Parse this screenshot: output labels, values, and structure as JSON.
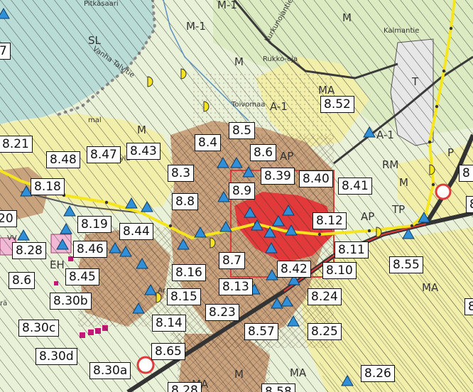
{
  "map": {
    "colors": {
      "background": "#e9f2d8",
      "agricultural": "#dcebc2",
      "water": "#b9dcd6",
      "yellow_zone": "#f2efaa",
      "housing": "#c9a27e",
      "centre_red": "#e23a3a",
      "industry": "#e7e7e7",
      "service_pink": "#f2b9d6",
      "route_yellow": "#f5e51e",
      "marker_blue": "#2f8fd8"
    },
    "zone_labels": [
      {
        "id": "sl",
        "text": "SL"
      },
      {
        "id": "m1-top",
        "text": "M-1"
      },
      {
        "id": "m1-mid",
        "text": "M-1"
      },
      {
        "id": "m-ne",
        "text": "M"
      },
      {
        "id": "m-n",
        "text": "M"
      },
      {
        "id": "m-w",
        "text": "M"
      },
      {
        "id": "ma-n",
        "text": "MA"
      },
      {
        "id": "a1-n",
        "text": "A-1"
      },
      {
        "id": "a1-e",
        "text": "A-1"
      },
      {
        "id": "t-e",
        "text": "T"
      },
      {
        "id": "p-e",
        "text": "P"
      },
      {
        "id": "ap-c",
        "text": "AP"
      },
      {
        "id": "ap-e",
        "text": "AP"
      },
      {
        "id": "rm-e",
        "text": "RM"
      },
      {
        "id": "m-e",
        "text": "M"
      },
      {
        "id": "tp-e",
        "text": "TP"
      },
      {
        "id": "ma-e",
        "text": "MA"
      },
      {
        "id": "eh-w",
        "text": "EH"
      },
      {
        "id": "ma-s",
        "text": "MA"
      },
      {
        "id": "m-s",
        "text": "M"
      },
      {
        "id": "ma-s2",
        "text": "MA"
      },
      {
        "id": "mal",
        "text": "mal"
      },
      {
        "id": "ar",
        "text": "Ar"
      },
      {
        "id": "ra",
        "text": "rä"
      },
      {
        "id": "vv",
        "text": "VV"
      }
    ],
    "place_names": [
      {
        "id": "kurkunojantie",
        "text": "Kurkunojantie"
      },
      {
        "id": "rukko-oja",
        "text": "Rukko-oja"
      },
      {
        "id": "kalmantie",
        "text": "Kalmantie"
      },
      {
        "id": "vanha-talvitie",
        "text": "Vanha Talvitie"
      },
      {
        "id": "rantakyla",
        "text": "Rantakylä"
      },
      {
        "id": "pitkasaari",
        "text": "Pitkäsaari"
      },
      {
        "id": "toivomaa",
        "text": "Toivomaa"
      }
    ],
    "callouts": [
      {
        "id": "7",
        "text": "7"
      },
      {
        "id": "8.52",
        "text": "8.52"
      },
      {
        "id": "8.5",
        "text": "8.5"
      },
      {
        "id": "8.21",
        "text": "8.21"
      },
      {
        "id": "8.48",
        "text": "8.48"
      },
      {
        "id": "8.47",
        "text": "8.47"
      },
      {
        "id": "8.43",
        "text": "8.43"
      },
      {
        "id": "8.4",
        "text": "8.4"
      },
      {
        "id": "8.6",
        "text": "8.6"
      },
      {
        "id": "8.39",
        "text": "8.39"
      },
      {
        "id": "8.40",
        "text": "8.40"
      },
      {
        "id": "8.41",
        "text": "8.41"
      },
      {
        "id": "8.3",
        "text": "8.3"
      },
      {
        "id": "8.9",
        "text": "8.9"
      },
      {
        "id": "8.18",
        "text": "8.18"
      },
      {
        "id": "8.8",
        "text": "8.8"
      },
      {
        "id": "20",
        "text": "20"
      },
      {
        "id": "8.19",
        "text": "8.19"
      },
      {
        "id": "8.44",
        "text": "8.44"
      },
      {
        "id": "8.12",
        "text": "8.12"
      },
      {
        "id": "8.28",
        "text": "8.28"
      },
      {
        "id": "8.46",
        "text": "8.46"
      },
      {
        "id": "8.11",
        "text": "8.11"
      },
      {
        "id": "8.7",
        "text": "8.7"
      },
      {
        "id": "8.55",
        "text": "8.55"
      },
      {
        "id": "8.6b",
        "text": "8.6"
      },
      {
        "id": "8.45",
        "text": "8.45"
      },
      {
        "id": "8.16",
        "text": "8.16"
      },
      {
        "id": "8.42",
        "text": "8.42"
      },
      {
        "id": "8.10",
        "text": "8.10"
      },
      {
        "id": "8.30b",
        "text": "8.30b"
      },
      {
        "id": "8.15",
        "text": "8.15"
      },
      {
        "id": "8.13",
        "text": "8.13"
      },
      {
        "id": "8.24",
        "text": "8.24"
      },
      {
        "id": "8.23",
        "text": "8.23"
      },
      {
        "id": "8.30c",
        "text": "8.30c"
      },
      {
        "id": "8.14",
        "text": "8.14"
      },
      {
        "id": "8.57",
        "text": "8.57"
      },
      {
        "id": "8.25",
        "text": "8.25"
      },
      {
        "id": "8.30d",
        "text": "8.30d"
      },
      {
        "id": "8.65",
        "text": "8.65"
      },
      {
        "id": "8.30a",
        "text": "8.30a"
      },
      {
        "id": "8.26",
        "text": "8.26"
      },
      {
        "id": "8.28b",
        "text": "8.28"
      },
      {
        "id": "8.58",
        "text": "8.58"
      },
      {
        "id": "8-edge-r1",
        "text": "8"
      },
      {
        "id": "8-edge-r2",
        "text": "8"
      },
      {
        "id": "8-edge-r3",
        "text": "8"
      }
    ]
  }
}
